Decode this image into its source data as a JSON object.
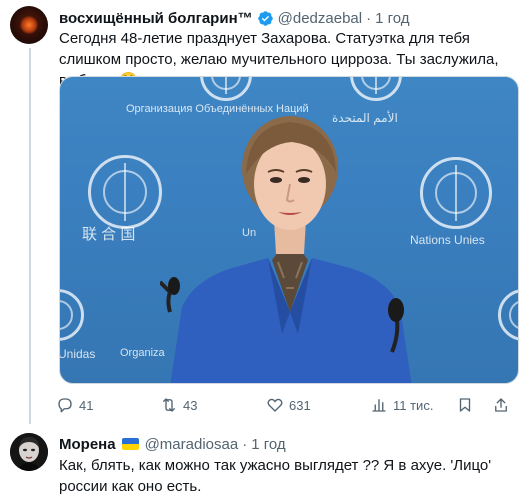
{
  "tweet": {
    "author_name": "восхищённый болгарин™",
    "author_handle": "@dedzaebal",
    "separator": "·",
    "time": "1 год",
    "text": "Сегодня 48-летие празднует Захарова. Статуэтка для тебя слишком просто, желаю мучительного цирроза. Ты заслужила, выблядь☺️",
    "media": {
      "watermarks": [
        "Организация Объединённых Наций",
        "الأمم المتحدة",
        "联 合 国",
        "Nations Unies",
        "Unidas",
        "Organiza",
        "Un"
      ]
    },
    "actions": {
      "replies": "41",
      "retweets": "43",
      "likes": "631",
      "views": "11 тис."
    }
  },
  "reply": {
    "author_name": "Морена",
    "author_handle": "@maradiosaa",
    "separator": "·",
    "time": "1 год",
    "text": "Как, блять, как можно так ужасно выглядет ?? Я в ахуе. 'Лицо' россии как оно есть."
  },
  "colors": {
    "text_primary": "#0f1419",
    "text_secondary": "#536471",
    "verified_blue": "#1d9bf0",
    "un_blue": "#3a7fbf"
  },
  "icons": [
    "verified-badge-icon",
    "reply-icon",
    "retweet-icon",
    "like-icon",
    "views-icon",
    "bookmark-icon",
    "ukraine-flag-icon"
  ]
}
